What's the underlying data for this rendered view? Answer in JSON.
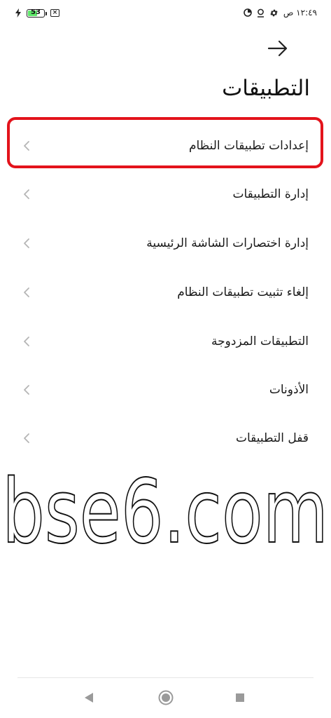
{
  "status_bar": {
    "battery_level": "53",
    "time": "١٢:٤٩ ص"
  },
  "header": {
    "title": "التطبيقات"
  },
  "menu": {
    "items": [
      {
        "label": "إعدادات تطبيقات النظام",
        "highlighted": true
      },
      {
        "label": "إدارة التطبيقات"
      },
      {
        "label": "إدارة اختصارات الشاشة الرئيسية"
      },
      {
        "label": "إلغاء تثبيت تطبيقات النظام"
      },
      {
        "label": "التطبيقات المزدوجة"
      },
      {
        "label": "الأذونات"
      },
      {
        "label": "قفل التطبيقات"
      }
    ]
  },
  "watermark": {
    "text": "bse6.com"
  },
  "colors": {
    "highlight": "#e3131b",
    "battery_fill": "#5ee86a",
    "chevron": "#b5b5b5"
  },
  "icons": [
    "charging-bolt-icon",
    "battery-icon",
    "sim-x-icon",
    "data-saver-icon",
    "location-icon",
    "settings-gear-icon",
    "back-arrow-icon",
    "chevron-left-icon",
    "nav-back-icon",
    "nav-home-icon",
    "nav-recents-icon"
  ]
}
